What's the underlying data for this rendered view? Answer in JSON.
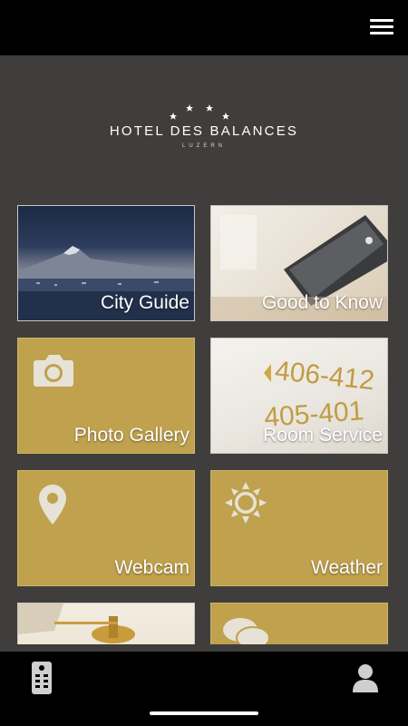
{
  "header": {
    "menu_icon": "hamburger-menu-icon"
  },
  "logo": {
    "stars": "★ ★ ★ ★",
    "name": "HOTEL DES BALANCES",
    "city": "LUZERN"
  },
  "tiles": [
    {
      "label": "City Guide",
      "style": "photo",
      "photo": "lake-mountain-view"
    },
    {
      "label": "Good to Know",
      "style": "photo",
      "photo": "tablet-on-desk"
    },
    {
      "label": "Photo Gallery",
      "style": "gold",
      "icon": "camera-icon"
    },
    {
      "label": "Room Service",
      "style": "photo",
      "photo": "room-number-sign"
    },
    {
      "label": "Webcam",
      "style": "gold",
      "icon": "location-pin-icon"
    },
    {
      "label": "Weather",
      "style": "gold",
      "icon": "sun-icon"
    },
    {
      "label": "",
      "style": "photo",
      "photo": "lamp-interior"
    },
    {
      "label": "",
      "style": "gold",
      "icon": "chat-bubbles-icon"
    }
  ],
  "footer": {
    "left_icon": "remote-control-icon",
    "right_icon": "user-profile-icon"
  },
  "colors": {
    "background": "#3f3e3c",
    "bars": "#000000",
    "gold_tile": "#bfa14e",
    "tile_text": "#ffffff"
  }
}
